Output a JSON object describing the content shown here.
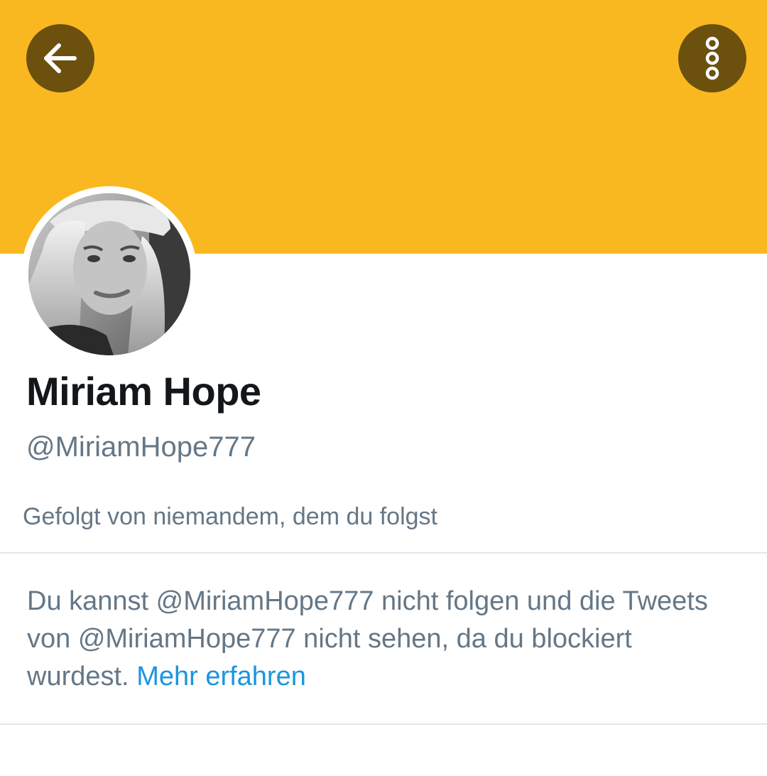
{
  "header": {
    "back_button_icon": "arrow-left-icon",
    "more_button_icon": "more-vertical-icon",
    "banner_color": "#FAB820",
    "button_color": "#6B500E"
  },
  "profile": {
    "display_name": "Miriam Hope",
    "handle": "@MiriamHope777",
    "followed_by": "Gefolgt von niemandem, dem du folgst"
  },
  "blocked_notice": {
    "text": "Du kannst @MiriamHope777 nicht folgen und die Tweets von @MiriamHope777 nicht sehen, da du blockiert wurdest.",
    "link_label": "Mehr erfahren",
    "link_color": "#1B95E0"
  }
}
